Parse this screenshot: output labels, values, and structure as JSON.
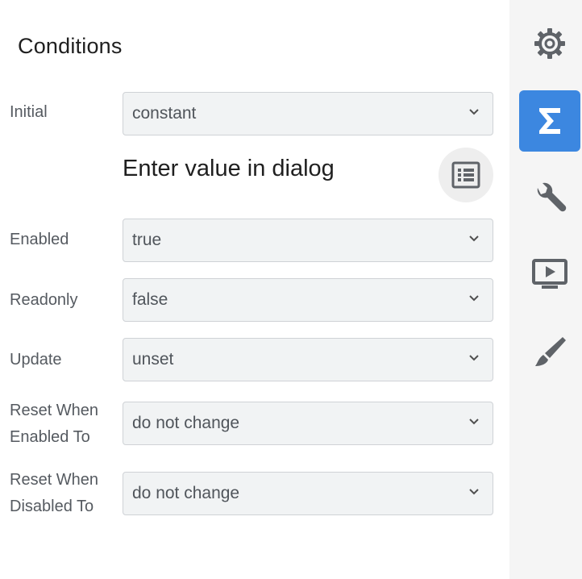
{
  "panel": {
    "title": "Conditions",
    "dialog_text": "Enter value in dialog",
    "rows": {
      "initial": {
        "label": "Initial",
        "value": "constant"
      },
      "enabled": {
        "label": "Enabled",
        "value": "true"
      },
      "readonly": {
        "label": "Readonly",
        "value": "false"
      },
      "update": {
        "label": "Update",
        "value": "unset"
      },
      "reset_enabled": {
        "label_line1": "Reset When",
        "label_line2": "Enabled To",
        "value": "do not change"
      },
      "reset_disabled": {
        "label_line1": "Reset When",
        "label_line2": "Disabled To",
        "value": "do not change"
      }
    }
  },
  "sidebar": {
    "items": [
      {
        "icon": "gear-icon",
        "active": false
      },
      {
        "icon": "sigma-icon",
        "active": true
      },
      {
        "icon": "wrench-icon",
        "active": false
      },
      {
        "icon": "play-screen-icon",
        "active": false
      },
      {
        "icon": "brush-icon",
        "active": false
      }
    ]
  },
  "colors": {
    "accent": "#3c87e0",
    "field_bg": "#f1f3f4",
    "sidebar_bg": "#f5f5f5"
  }
}
